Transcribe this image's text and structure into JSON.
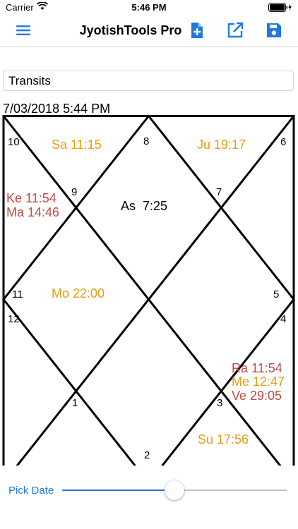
{
  "status_bar": {
    "carrier": "Carrier",
    "time": "5:46 PM"
  },
  "nav": {
    "title": "JyotishTools Pro",
    "menu_icon": "hamburger-menu-icon",
    "actions": [
      "new-chart-icon",
      "edit-external-icon",
      "save-icon"
    ],
    "accent_color": "#1e7ae0"
  },
  "chart_name": "Transits",
  "datetime": "7/03/2018 5:44 PM",
  "chart": {
    "house_numbers": [
      "1",
      "2",
      "3",
      "4",
      "5",
      "6",
      "7",
      "8",
      "9",
      "10",
      "11",
      "12"
    ],
    "planets": {
      "sa": "Sa 11:15",
      "ju": "Ju 19:17",
      "ke": "Ke 11:54",
      "ma": "Ma 14:46",
      "as": "As  7:25",
      "mo": "Mo 22:00",
      "ra": "Ra 11:54",
      "me": "Me 12:47",
      "ve": "Ve 29:05",
      "su": "Su 17:56"
    },
    "colors": {
      "benefic": "#e89d10",
      "malefic": "#c24848",
      "lagna": "#000000"
    }
  },
  "bottom": {
    "pick_date_label": "Pick Date",
    "slider_value_fraction": 0.5
  }
}
